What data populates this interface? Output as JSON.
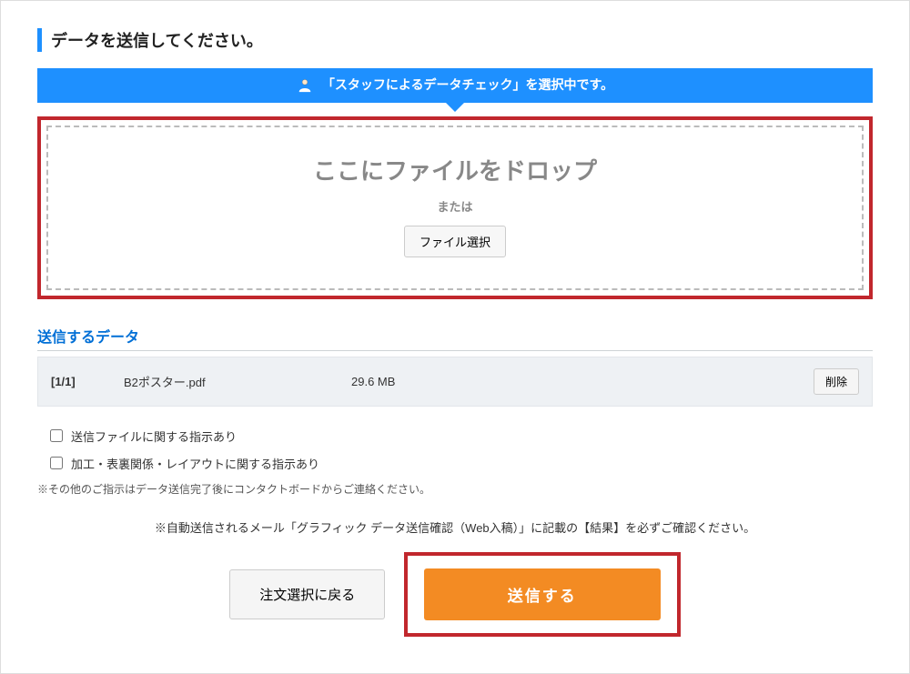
{
  "page_title": "データを送信してください。",
  "banner": {
    "text": "「スタッフによるデータチェック」を選択中です。"
  },
  "dropzone": {
    "title": "ここにファイルをドロップ",
    "or": "または",
    "select_button": "ファイル選択"
  },
  "files_section_title": "送信するデータ",
  "file": {
    "index": "[1/1]",
    "name": "B2ポスター.pdf",
    "size": "29.6 MB",
    "delete_label": "削除"
  },
  "checkboxes": {
    "opt1": "送信ファイルに関する指示あり",
    "opt2": "加工・表裏関係・レイアウトに関する指示あり"
  },
  "note": "※その他のご指示はデータ送信完了後にコンタクトボードからご連絡ください。",
  "confirm_note": "※自動送信されるメール「グラフィック データ送信確認（Web入稿）」に記載の【結果】を必ずご確認ください。",
  "buttons": {
    "back": "注文選択に戻る",
    "submit": "送信する"
  }
}
